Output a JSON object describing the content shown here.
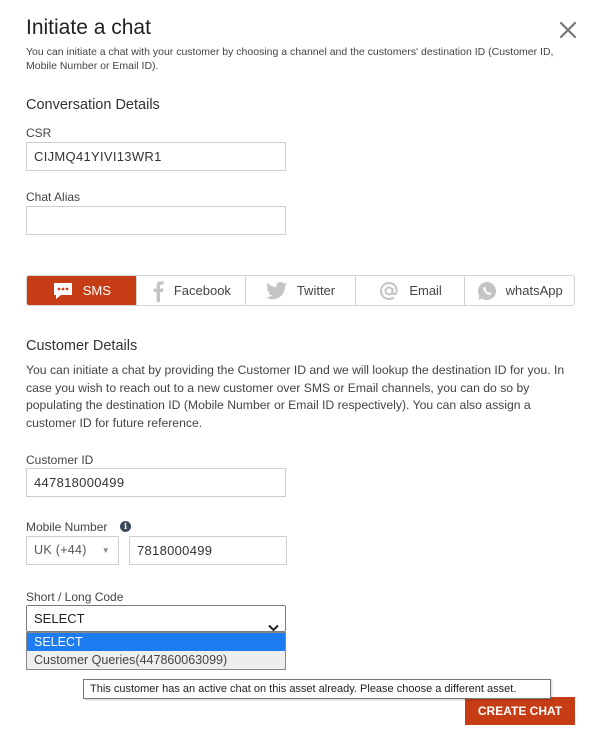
{
  "dialog": {
    "title": "Initiate a chat",
    "subtitle": "You can initiate a chat with your customer by choosing a channel and the customers' destination ID (Customer ID, Mobile Number or Email ID)."
  },
  "conversation": {
    "section_title": "Conversation Details",
    "csr_label": "CSR",
    "csr_value": "CIJMQ41YIVI13WR1",
    "alias_label": "Chat Alias",
    "alias_value": ""
  },
  "channels": [
    {
      "label": "SMS",
      "icon": "sms-icon",
      "active": true
    },
    {
      "label": "Facebook",
      "icon": "facebook-icon",
      "active": false
    },
    {
      "label": "Twitter",
      "icon": "twitter-icon",
      "active": false
    },
    {
      "label": "Email",
      "icon": "at-icon",
      "active": false
    },
    {
      "label": "whatsApp",
      "icon": "whatsapp-icon",
      "active": false
    }
  ],
  "customer": {
    "section_title": "Customer Details",
    "description": "You can initiate a chat by providing the Customer ID and we will lookup the destination ID for you. In case you wish to reach out to a new customer over SMS or Email channels, you can do so by populating the destination ID (Mobile Number or Email ID respectively). You can also assign a customer ID for future reference.",
    "customer_id_label": "Customer ID",
    "customer_id_value": "447818000499",
    "mobile_label": "Mobile Number",
    "country_code": "UK (+44)",
    "mobile_value": "7818000499",
    "code_label": "Short / Long Code",
    "code_selected": "SELECT",
    "code_options": [
      "SELECT",
      "Customer Queries(447860063099)"
    ]
  },
  "tooltip": "This customer has an active chat on this asset already. Please choose a different asset.",
  "create_button": "CREATE CHAT",
  "colors": {
    "accent": "#c63d15",
    "select_highlight": "#1e7cf2"
  }
}
